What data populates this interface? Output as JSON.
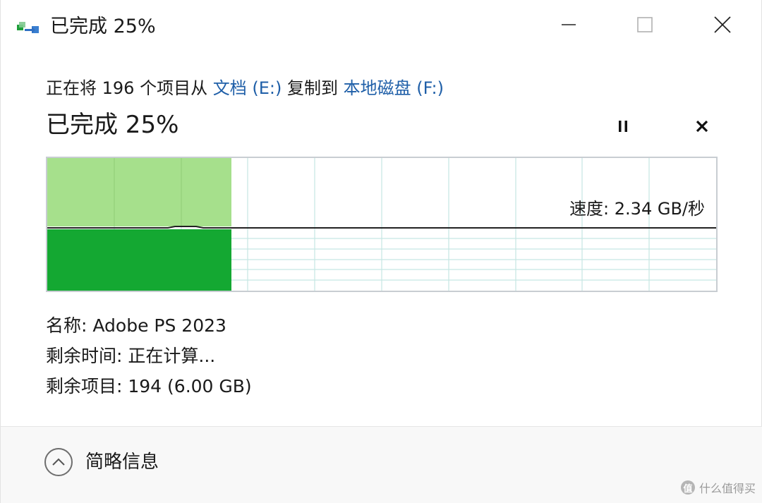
{
  "window": {
    "title": "已完成 25%",
    "controls": {
      "minimize_icon": "minimize-icon",
      "maximize_icon": "maximize-icon",
      "close_icon": "close-icon"
    }
  },
  "operation": {
    "prefix": "正在将 196 个项目从 ",
    "source": "文档 (E:)",
    "middle": " 复制到 ",
    "destination": "本地磁盘 (F:)",
    "link_color": "#1f5fa8"
  },
  "progress": {
    "label": "已完成 25%",
    "percent": 25,
    "pause_icon": "pause-icon",
    "stop_icon": "stop-icon"
  },
  "speed_graph": {
    "speed_text": "速度: 2.34 GB/秒",
    "fill_fraction": 0.275,
    "light_green": "#a6e08c",
    "dark_green": "#14a832",
    "grid_color": "#c5e6e3",
    "line_color": "#222222"
  },
  "details": {
    "name": "名称: Adobe PS 2023",
    "time_remaining": "剩余时间: 正在计算...",
    "items_remaining": "剩余项目: 194 (6.00 GB)"
  },
  "footer": {
    "toggle_label": "简略信息",
    "toggle_icon": "chevron-up-icon"
  },
  "watermark": {
    "badge": "值",
    "text": "什么值得买"
  }
}
